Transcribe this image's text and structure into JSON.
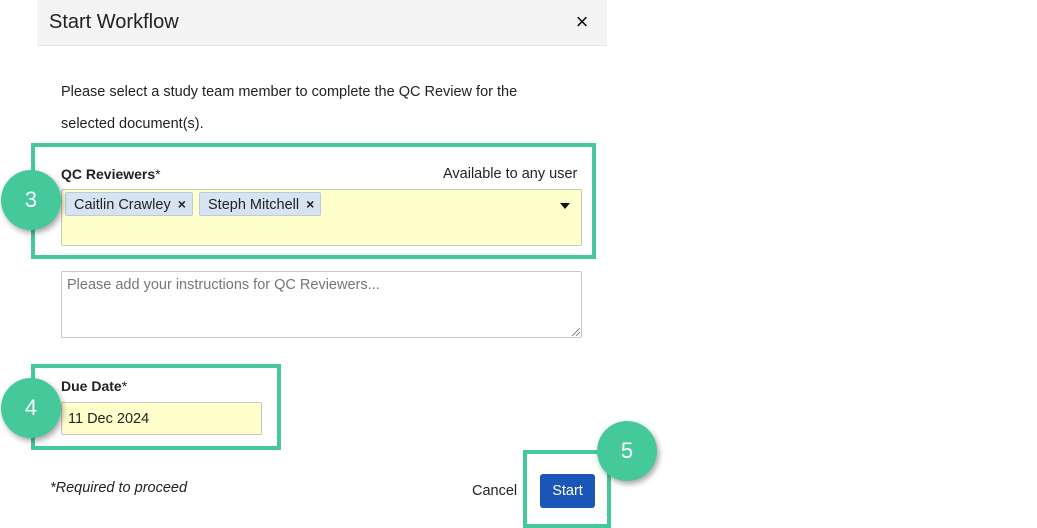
{
  "dialog": {
    "title": "Start Workflow",
    "close_icon": "×",
    "instructions": "Please select a study team member to complete the QC Review for the selected document(s)."
  },
  "reviewers": {
    "label": "QC Reviewers",
    "required_mark": "*",
    "availability": "Available to any user",
    "selected": [
      "Caitlin Crawley",
      "Steph Mitchell"
    ],
    "remove_icon": "×"
  },
  "instructions_field": {
    "value": "",
    "placeholder": "Please add your instructions for QC Reviewers..."
  },
  "due_date": {
    "label": "Due Date",
    "required_mark": "*",
    "value": "11 Dec 2024"
  },
  "footer": {
    "required_note": "*Required to proceed",
    "cancel_label": "Cancel",
    "start_label": "Start"
  },
  "annotations": {
    "step_3": "3",
    "step_4": "4",
    "step_5": "5",
    "highlight_color": "#45c99b"
  },
  "colors": {
    "primary_button": "#1a56b8",
    "required_field_bg": "#ffffcc",
    "chip_bg": "#d6e4f2"
  }
}
